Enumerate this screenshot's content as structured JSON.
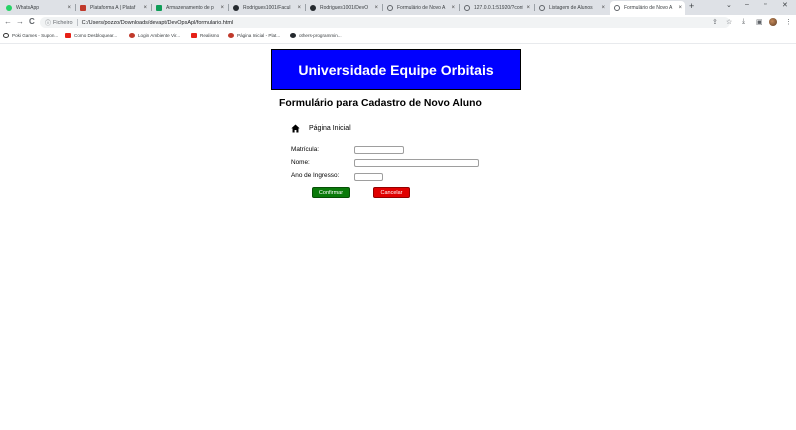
{
  "browser": {
    "tabs": [
      {
        "label": "WhatsApp",
        "color": "#25d366",
        "active": false
      },
      {
        "label": "Plataforma A | Plataf",
        "color": "#c0392b",
        "active": false
      },
      {
        "label": "Armazenamento de p",
        "color": "#0f9d58",
        "active": false
      },
      {
        "label": "Rodrigues1001/Facul",
        "color": "#24292e",
        "active": false
      },
      {
        "label": "Rodrigues1001/DevO",
        "color": "#24292e",
        "active": false
      },
      {
        "label": "Formulário de Novo A",
        "color": "#5f6368",
        "active": false
      },
      {
        "label": "127.0.0.1:51920/?conf",
        "color": "#5f6368",
        "active": false
      },
      {
        "label": "Listagem de Alunos",
        "color": "#5f6368",
        "active": false
      },
      {
        "label": "Formulário de Novo A",
        "color": "#5f6368",
        "active": true
      }
    ],
    "new_tab_label": "+",
    "close_glyph": "×",
    "window_controls": {
      "menu": "⌄",
      "minimize": "–",
      "maximize": "▫",
      "close": "✕"
    },
    "nav": {
      "back": "←",
      "forward": "→",
      "reload": "C"
    },
    "address": {
      "info_icon": "ⓘ",
      "scheme_label": "Ficheiro",
      "url": "C:/Users/pozzo/Downloads/devapt/DevOpsApl/formulario.html"
    },
    "toolbar_icons": {
      "share": "⇪",
      "star": "☆",
      "download": "⤓",
      "sidebar": "▣",
      "menu": "⋮"
    },
    "bookmarks": [
      {
        "label": "Poki Games - Supon...",
        "color": "#333333"
      },
      {
        "label": "Como Desbloquear...",
        "color": "#e62117"
      },
      {
        "label": "Login Ambiente Vir...",
        "color": "#c0392b"
      },
      {
        "label": "Realismo",
        "color": "#e62117"
      },
      {
        "label": "Página Inicial - Plat...",
        "color": "#c0392b"
      },
      {
        "label": "others-programmin...",
        "color": "#24292e"
      }
    ]
  },
  "page": {
    "banner_title": "Universidade Equipe Orbitais",
    "heading": "Formulário para Cadastro de Novo Aluno",
    "home_link_label": "Página Inicial",
    "form": {
      "matricula_label": "Matrícula:",
      "matricula_value": "",
      "nome_label": "Nome:",
      "nome_value": "",
      "ano_label": "Ano de Ingresso:",
      "ano_value": "",
      "confirm_label": "Confirmar",
      "cancel_label": "Cancelar"
    },
    "colors": {
      "banner_bg": "#0000ff",
      "confirm_bg": "#0a7a0a",
      "cancel_bg": "#e00000"
    }
  }
}
